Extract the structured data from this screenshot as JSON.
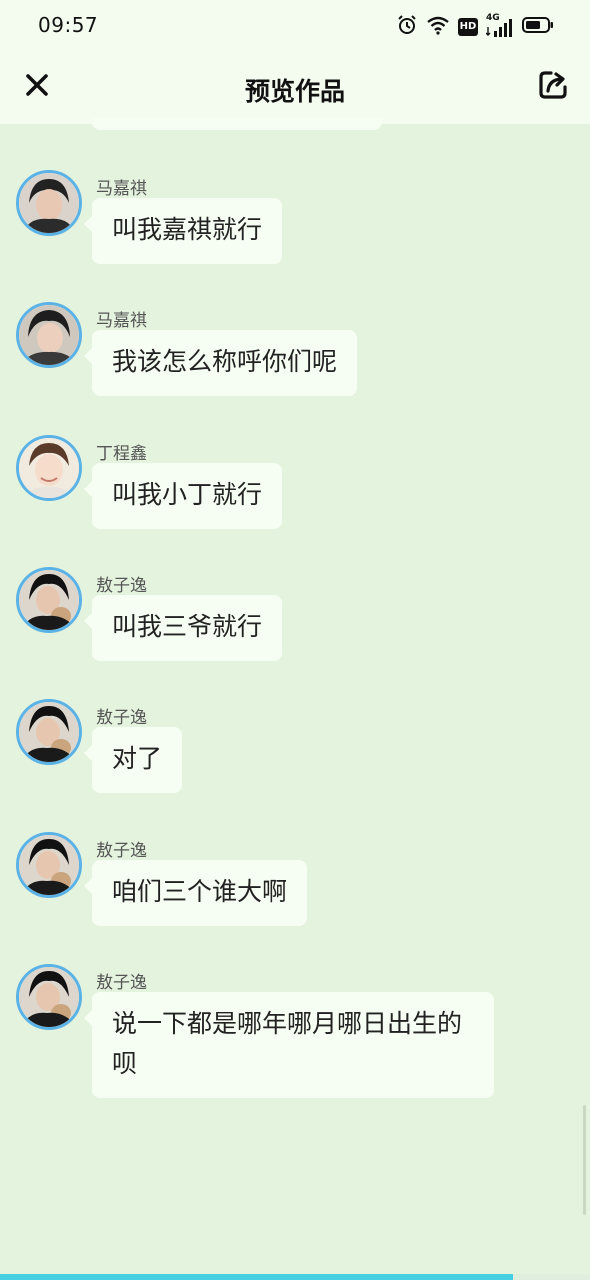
{
  "status_bar": {
    "time": "09:57",
    "icons": [
      "alarm-icon",
      "wifi-icon",
      "hd-icon",
      "signal-4g-icon",
      "battery-icon"
    ],
    "hd_label": "HD",
    "network_label": "4G"
  },
  "nav": {
    "close_icon": "close-icon",
    "title": "预览作品",
    "share_icon": "share-icon"
  },
  "messages": [
    {
      "sender": "马嘉祺",
      "text": "叫我嘉祺就行",
      "avatar": "avatar-ma-jiaqi"
    },
    {
      "sender": "马嘉祺",
      "text": "我该怎么称呼你们呢",
      "avatar": "avatar-ma-jiaqi"
    },
    {
      "sender": "丁程鑫",
      "text": "叫我小丁就行",
      "avatar": "avatar-ding-chengxin"
    },
    {
      "sender": "敖子逸",
      "text": "叫我三爷就行",
      "avatar": "avatar-ao-ziyi"
    },
    {
      "sender": "敖子逸",
      "text": "对了",
      "avatar": "avatar-ao-ziyi"
    },
    {
      "sender": "敖子逸",
      "text": "咱们三个谁大啊",
      "avatar": "avatar-ao-ziyi"
    },
    {
      "sender": "敖子逸",
      "text": "说一下都是哪年哪月哪日出生的呗",
      "avatar": "avatar-ao-ziyi"
    }
  ],
  "playback_progress": 0.87,
  "colors": {
    "background": "#e4f3dd",
    "bubble": "#f6fdf2",
    "avatar_border": "#5ab2e6",
    "progress": "#45cfe0"
  }
}
